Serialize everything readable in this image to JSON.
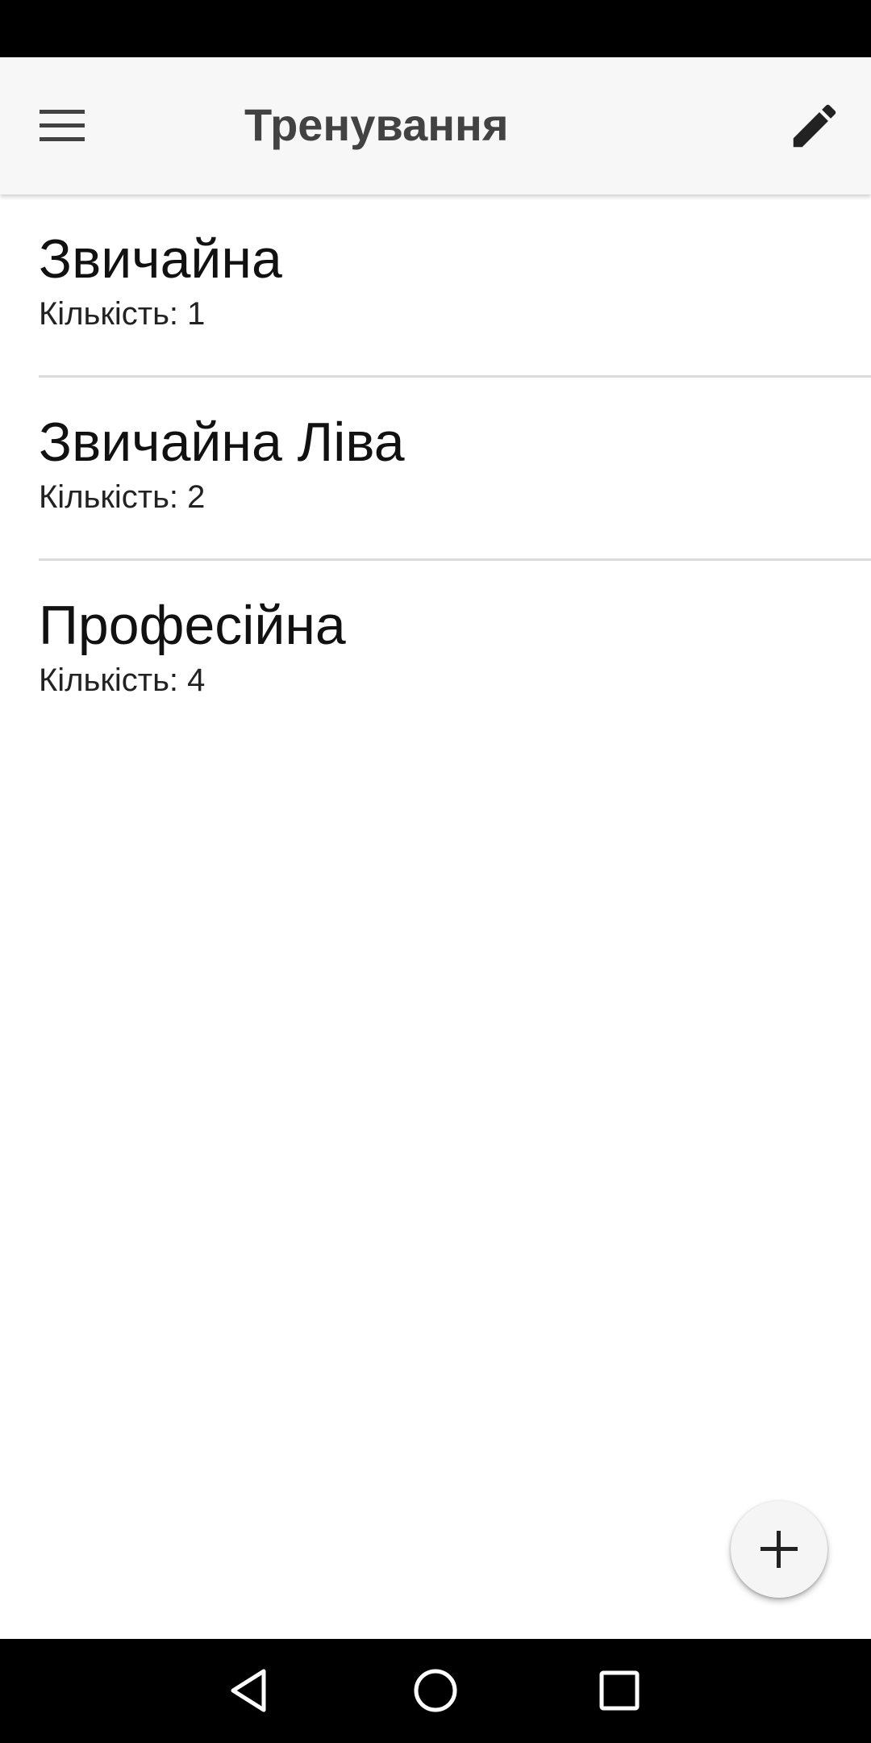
{
  "app_bar": {
    "title": "Тренування",
    "menu_icon": "hamburger-menu-icon",
    "edit_icon": "pencil-icon"
  },
  "items": [
    {
      "title": "Звичайна",
      "subtitle": "Кількість: 1"
    },
    {
      "title": "Звичайна Ліва",
      "subtitle": "Кількість: 2"
    },
    {
      "title": "Професійна",
      "subtitle": "Кількість: 4"
    }
  ],
  "fab": {
    "icon": "plus-icon"
  },
  "nav": {
    "icons": [
      "back-icon",
      "home-icon",
      "recents-icon"
    ]
  },
  "colors": {
    "app_bar_bg": "#f7f7f7",
    "title_text": "#424242",
    "divider": "#dcdcdc",
    "system_bars": "#000000"
  }
}
